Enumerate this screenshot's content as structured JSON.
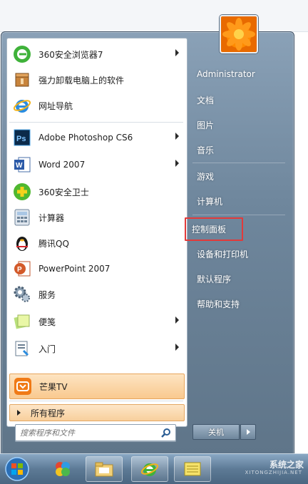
{
  "user": {
    "name": "Administrator"
  },
  "programs": [
    {
      "label": "360安全浏览器7",
      "icon": "360-browser-icon",
      "submenu": true
    },
    {
      "label": "强力卸载电脑上的软件",
      "icon": "uninstall-box-icon",
      "submenu": false
    },
    {
      "label": "网址导航",
      "icon": "ie-icon",
      "submenu": false
    },
    {
      "label": "Adobe Photoshop CS6",
      "icon": "photoshop-icon",
      "submenu": true
    },
    {
      "label": "Word 2007",
      "icon": "word-icon",
      "submenu": true
    },
    {
      "label": "360安全卫士",
      "icon": "360-safeguard-icon",
      "submenu": false
    },
    {
      "label": "计算器",
      "icon": "calculator-icon",
      "submenu": false
    },
    {
      "label": "腾讯QQ",
      "icon": "qq-penguin-icon",
      "submenu": false
    },
    {
      "label": "PowerPoint 2007",
      "icon": "powerpoint-icon",
      "submenu": false
    },
    {
      "label": "服务",
      "icon": "services-gear-icon",
      "submenu": false
    },
    {
      "label": "便笺",
      "icon": "sticky-notes-icon",
      "submenu": true
    },
    {
      "label": "入门",
      "icon": "getting-started-icon",
      "submenu": true
    },
    {
      "label": "芒果TV",
      "icon": "mango-tv-icon",
      "submenu": false
    }
  ],
  "all_programs_label": "所有程序",
  "search": {
    "placeholder": "搜索程序和文件"
  },
  "right_items": {
    "documents": "文档",
    "pictures": "图片",
    "music": "音乐",
    "games": "游戏",
    "computer": "计算机",
    "control_panel": "控制面板",
    "devices_printers": "设备和打印机",
    "default_programs": "默认程序",
    "help_support": "帮助和支持"
  },
  "shutdown_label": "关机",
  "watermark": {
    "main": "系统之家",
    "sub": "XITONGZHIJIA.NET"
  },
  "colors": {
    "highlight_border": "#e23a3a",
    "menu_bg": "#6f879d",
    "hover_orange": "#f9c98f"
  }
}
